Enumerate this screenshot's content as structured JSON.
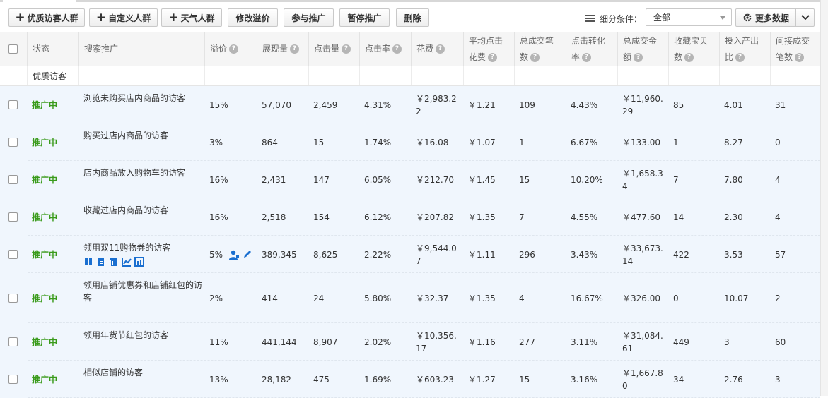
{
  "toolbar": {
    "btn_quality": "优质访客人群",
    "btn_custom": "自定义人群",
    "btn_weather": "天气人群",
    "btn_premium": "修改溢价",
    "btn_join": "参与推广",
    "btn_pause": "暂停推广",
    "btn_delete": "删除",
    "filter_label": "细分条件：",
    "filter_value": "全部",
    "more_data": "更多数据"
  },
  "headers": {
    "status": "状态",
    "search": "搜索推广",
    "premium": "溢价",
    "impressions": "展现量",
    "clicks": "点击量",
    "ctr": "点击率",
    "cost": "花费",
    "avg_cpc": "平均点击花费",
    "total_orders": "总成交笔数",
    "cvr": "点击转化率",
    "total_amount": "总成交金额",
    "favorites": "收藏宝贝数",
    "roi": "投入产出比",
    "indirect_orders": "间接成交笔数"
  },
  "group_label": "优质访客",
  "rows": [
    {
      "status": "推广中",
      "name": "浏览未购买店内商品的访客",
      "premium": "15%",
      "impressions": "57,070",
      "clicks": "2,459",
      "ctr": "4.31%",
      "cost": "￥2,983.22",
      "cpc": "￥1.21",
      "orders": "109",
      "cvr": "4.43%",
      "amount": "￥11,960.29",
      "favorites": "85",
      "roi": "4.01",
      "indirect": "31"
    },
    {
      "status": "推广中",
      "name": "购买过店内商品的访客",
      "premium": "3%",
      "impressions": "864",
      "clicks": "15",
      "ctr": "1.74%",
      "cost": "￥16.08",
      "cpc": "￥1.07",
      "orders": "1",
      "cvr": "6.67%",
      "amount": "￥133.00",
      "favorites": "1",
      "roi": "8.27",
      "indirect": "0"
    },
    {
      "status": "推广中",
      "name": "店内商品放入购物车的访客",
      "premium": "16%",
      "impressions": "2,431",
      "clicks": "147",
      "ctr": "6.05%",
      "cost": "￥212.70",
      "cpc": "￥1.45",
      "orders": "15",
      "cvr": "10.20%",
      "amount": "￥1,658.34",
      "favorites": "7",
      "roi": "7.80",
      "indirect": "4"
    },
    {
      "status": "推广中",
      "name": "收藏过店内商品的访客",
      "premium": "16%",
      "impressions": "2,518",
      "clicks": "154",
      "ctr": "6.12%",
      "cost": "￥207.82",
      "cpc": "￥1.35",
      "orders": "7",
      "cvr": "4.55%",
      "amount": "￥477.60",
      "favorites": "14",
      "roi": "2.30",
      "indirect": "4"
    },
    {
      "status": "推广中",
      "name": "领用双11购物券的访客",
      "premium": "5%",
      "impressions": "389,345",
      "clicks": "8,625",
      "ctr": "2.22%",
      "cost": "￥9,544.07",
      "cpc": "￥1.11",
      "orders": "296",
      "cvr": "3.43%",
      "amount": "￥33,673.14",
      "favorites": "422",
      "roi": "3.53",
      "indirect": "57"
    },
    {
      "status": "推广中",
      "name": "领用店铺优惠券和店铺红包的访客",
      "premium": "2%",
      "impressions": "414",
      "clicks": "24",
      "ctr": "5.80%",
      "cost": "￥32.37",
      "cpc": "￥1.35",
      "orders": "4",
      "cvr": "16.67%",
      "amount": "￥326.00",
      "favorites": "0",
      "roi": "10.07",
      "indirect": "2"
    },
    {
      "status": "推广中",
      "name": "领用年货节红包的访客",
      "premium": "11%",
      "impressions": "441,144",
      "clicks": "8,907",
      "ctr": "2.02%",
      "cost": "￥10,356.17",
      "cpc": "￥1.16",
      "orders": "277",
      "cvr": "3.11%",
      "amount": "￥31,084.61",
      "favorites": "449",
      "roi": "3",
      "indirect": "60"
    },
    {
      "status": "推广中",
      "name": "相似店铺的访客",
      "premium": "13%",
      "impressions": "28,182",
      "clicks": "475",
      "ctr": "1.69%",
      "cost": "￥603.23",
      "cpc": "￥1.27",
      "orders": "15",
      "cvr": "3.16%",
      "amount": "￥1,667.80",
      "favorites": "34",
      "roi": "2.76",
      "indirect": "3"
    }
  ],
  "colors": {
    "status_green": "#3a9b1b",
    "row_bg": "#f0f6fd",
    "icon_blue": "#1a6fd0"
  },
  "icons": [
    "plus-icon",
    "list-icon",
    "caret-down-icon",
    "gear-icon",
    "chevron-down-icon",
    "question-icon",
    "checkbox",
    "user-edit-icon",
    "pencil-icon",
    "pause-icon",
    "clipboard-icon",
    "trash-icon",
    "trend-chart-icon",
    "report-icon"
  ]
}
